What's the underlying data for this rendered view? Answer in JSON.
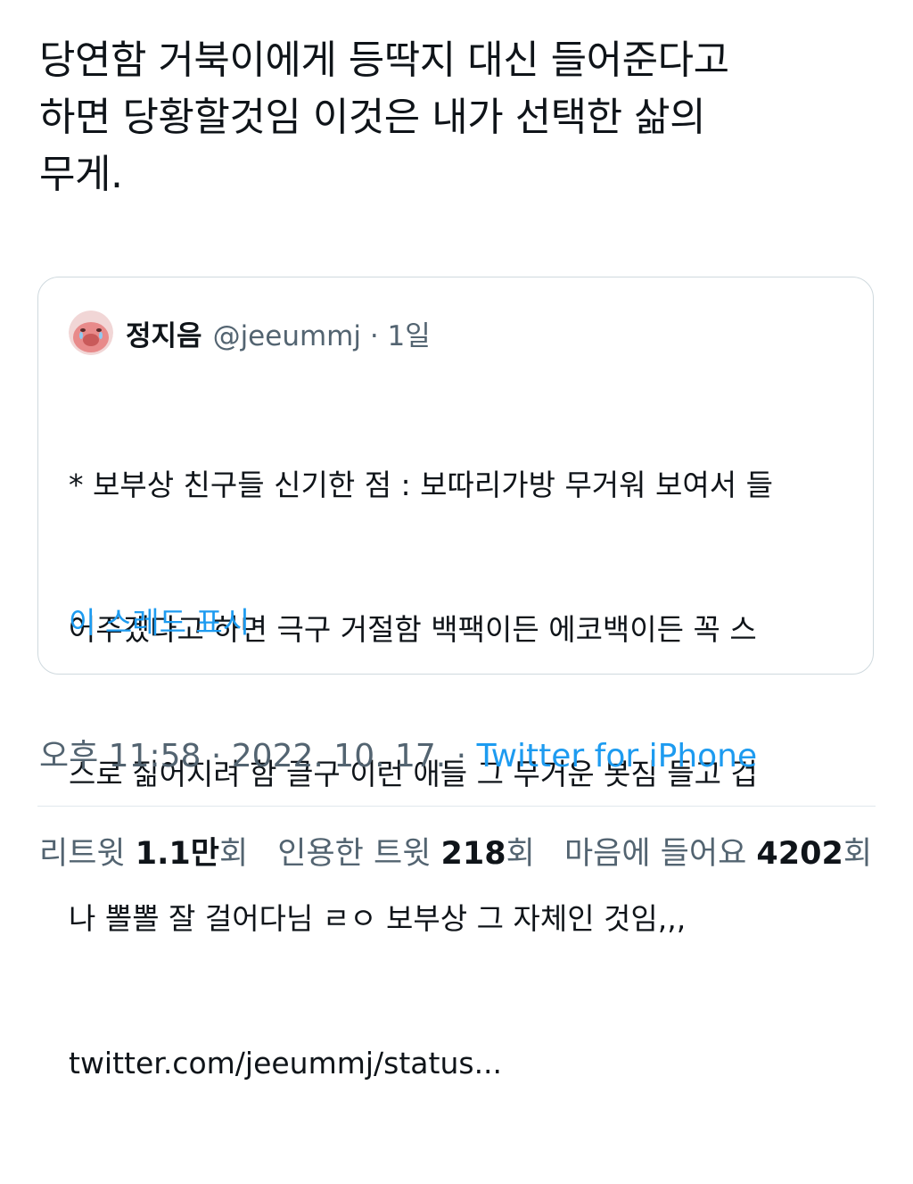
{
  "tweet": {
    "text": "당연함 거북이에게 등딱지 대신 들어준다고\n하면 당황할것임 이것은 내가 선택한 삶의\n무게."
  },
  "quote": {
    "name": "정지음",
    "handle": "@jeeummj · 1일",
    "body_lines": [
      "* 보부상 친구들 신기한 점 : 보따리가방 무거워 보여서 들",
      "어주겠다고 하면 극구 거절함 백팩이든 에코백이든 꼭 스",
      "스로 짊어지려 함 글구 이런 애들 그 무거운 봇짐 들고 겁",
      "나 뽈뽈 잘 걸어다님 ㄹㅇ 보부상 그 자체인 것임,,,"
    ],
    "link": "twitter.com/jeeummj/status...",
    "show_thread": "이 스레드 표시"
  },
  "meta": {
    "time": "오후 11:58",
    "sep1": " · ",
    "date": "2022. 10. 17.",
    "sep2": " · ",
    "source": "Twitter for iPhone"
  },
  "stats": {
    "retweets_label": "리트윗 ",
    "retweets_count": "1.1만",
    "retweets_suffix": "회",
    "quotes_label": "인용한 트윗 ",
    "quotes_count": "218",
    "quotes_suffix": "회",
    "likes_label": "마음에 들어요 ",
    "likes_count": "4202",
    "likes_suffix": "회"
  },
  "colors": {
    "accent": "#1d9bf0",
    "secondary_text": "#536471",
    "border": "#cfd9de",
    "avatar_bg": "#e88a8a"
  },
  "icons": {
    "avatar": "crying-character-avatar"
  }
}
